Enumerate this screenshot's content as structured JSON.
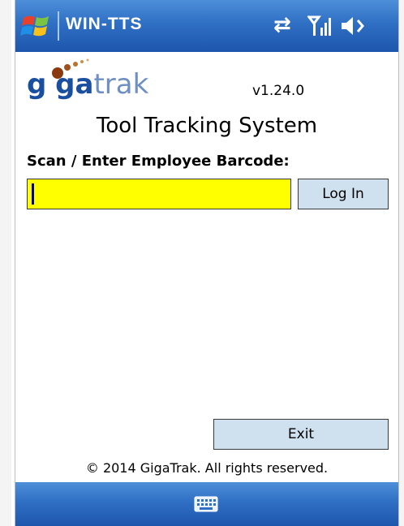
{
  "titlebar": {
    "app_title": "WIN-TTS",
    "icons": [
      "windows-start-icon",
      "connectivity-icon",
      "signal-icon",
      "volume-icon"
    ]
  },
  "logo": {
    "text_g": "g",
    "text_ga": "ga",
    "text_trak": "trak"
  },
  "version": "v1.24.0",
  "heading": "Tool Tracking System",
  "prompt": "Scan / Enter Employee Barcode:",
  "barcode_input": {
    "value": "",
    "placeholder": ""
  },
  "buttons": {
    "login": "Log In",
    "exit": "Exit"
  },
  "copyright": "© 2014 GigaTrak.  All rights reserved.",
  "menubar": {
    "icons": [
      "keyboard-icon"
    ]
  },
  "colors": {
    "titlebar": "#2f6fc4",
    "input_bg": "#ffff00",
    "button_bg": "#cfe0ef",
    "logo_blue": "#1a4fa0",
    "logo_brown": "#8b3a10"
  }
}
